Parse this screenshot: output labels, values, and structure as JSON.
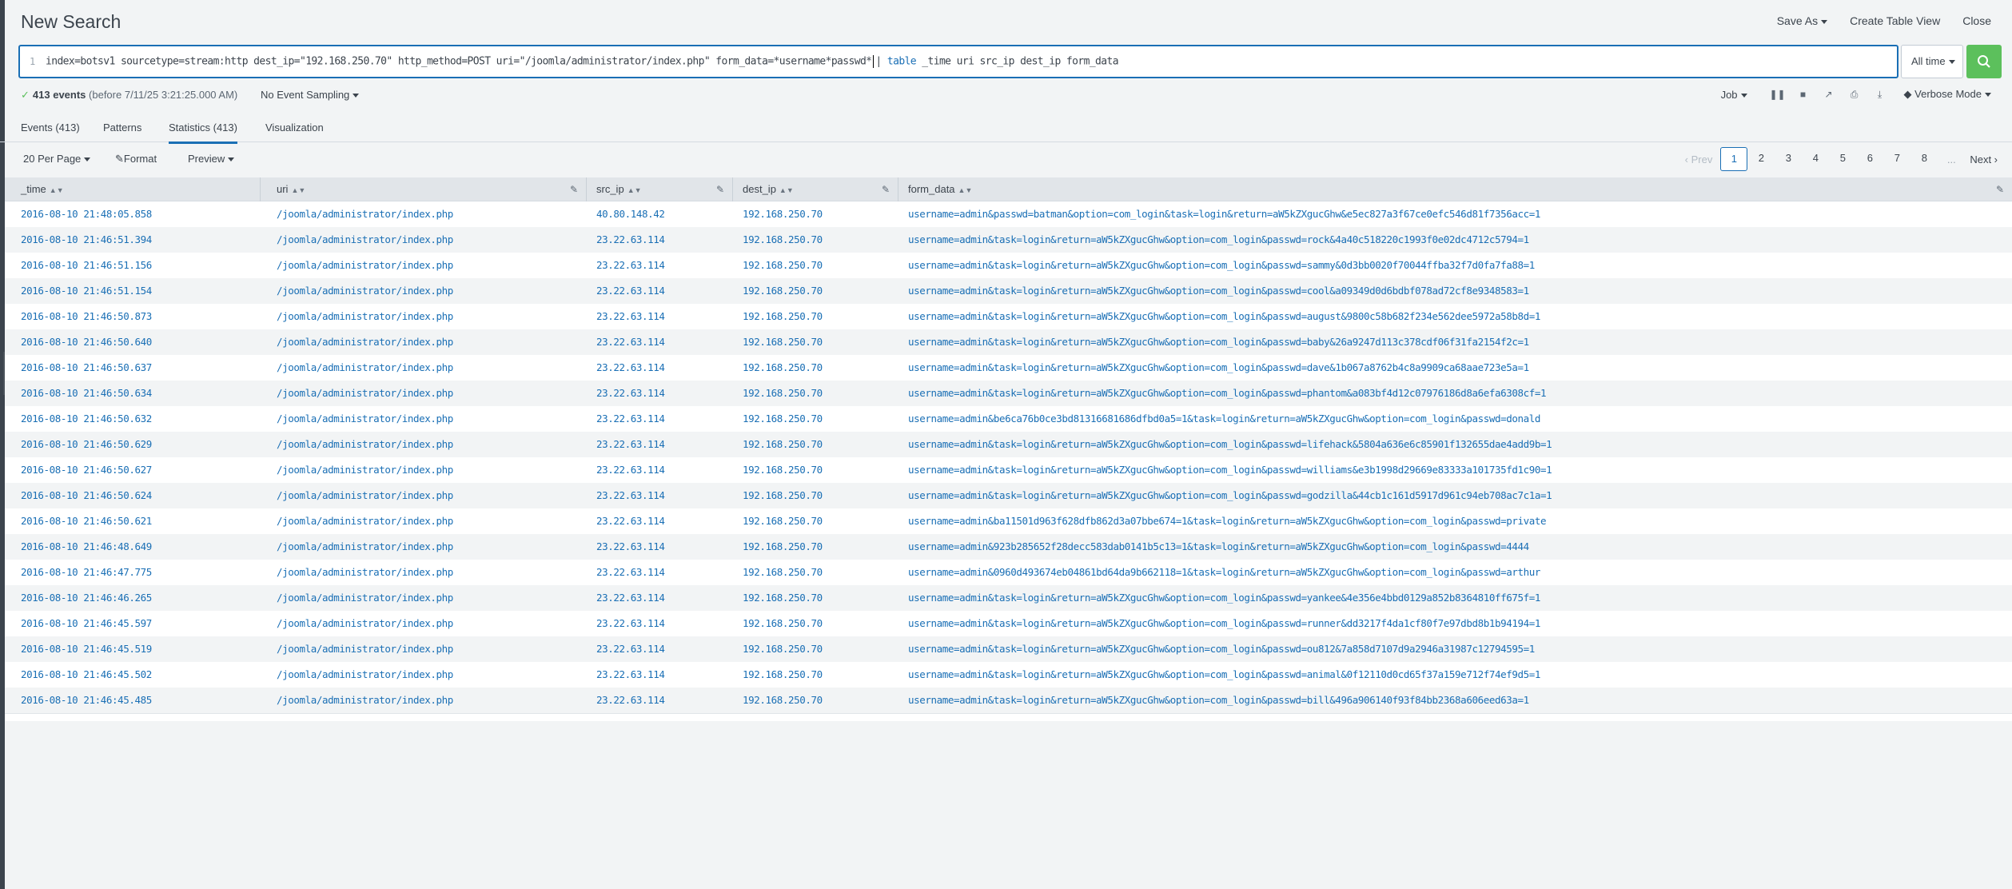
{
  "page": {
    "title": "New Search",
    "top_links": [
      "Save As",
      "Create Table View",
      "Close"
    ]
  },
  "search": {
    "line_number": "1",
    "query_part1": "index=botsv1 sourcetype=stream:http dest_ip=\"192.168.250.70\" http_method=POST uri=\"/joomla/administrator/index.php\" form_data=*username*passwd*",
    "pipe": "| ",
    "command": "table",
    "query_part2": " _time uri src_ip dest_ip form_data",
    "time_range": "All time"
  },
  "status": {
    "check": "✓",
    "events": "413 events",
    "sub": "(before 7/11/25 3:21:25.000 AM)",
    "sampling": "No Event Sampling",
    "job": "Job",
    "mode": "Verbose Mode"
  },
  "tabs": [
    "Events (413)",
    "Patterns",
    "Statistics (413)",
    "Visualization"
  ],
  "toolbar": {
    "per_page": "20 Per Page",
    "format": "Format",
    "preview": "Preview"
  },
  "pager": {
    "prev": "‹ Prev",
    "pages": [
      "1",
      "2",
      "3",
      "4",
      "5",
      "6",
      "7",
      "8"
    ],
    "dots": "...",
    "next": "Next ›",
    "current": "1"
  },
  "columns": [
    "_time",
    "uri",
    "src_ip",
    "dest_ip",
    "form_data"
  ],
  "rows": [
    [
      "2016-08-10 21:48:05.858",
      "/joomla/administrator/index.php",
      "40.80.148.42",
      "192.168.250.70",
      "username=admin&passwd=batman&option=com_login&task=login&return=aW5kZXgucGhw&e5ec827a3f67ce0efc546d81f7356acc=1"
    ],
    [
      "2016-08-10 21:46:51.394",
      "/joomla/administrator/index.php",
      "23.22.63.114",
      "192.168.250.70",
      "username=admin&task=login&return=aW5kZXgucGhw&option=com_login&passwd=rock&4a40c518220c1993f0e02dc4712c5794=1"
    ],
    [
      "2016-08-10 21:46:51.156",
      "/joomla/administrator/index.php",
      "23.22.63.114",
      "192.168.250.70",
      "username=admin&task=login&return=aW5kZXgucGhw&option=com_login&passwd=sammy&0d3bb0020f70044ffba32f7d0fa7fa88=1"
    ],
    [
      "2016-08-10 21:46:51.154",
      "/joomla/administrator/index.php",
      "23.22.63.114",
      "192.168.250.70",
      "username=admin&task=login&return=aW5kZXgucGhw&option=com_login&passwd=cool&a09349d0d6bdbf078ad72cf8e9348583=1"
    ],
    [
      "2016-08-10 21:46:50.873",
      "/joomla/administrator/index.php",
      "23.22.63.114",
      "192.168.250.70",
      "username=admin&task=login&return=aW5kZXgucGhw&option=com_login&passwd=august&9800c58b682f234e562dee5972a58b8d=1"
    ],
    [
      "2016-08-10 21:46:50.640",
      "/joomla/administrator/index.php",
      "23.22.63.114",
      "192.168.250.70",
      "username=admin&task=login&return=aW5kZXgucGhw&option=com_login&passwd=baby&26a9247d113c378cdf06f31fa2154f2c=1"
    ],
    [
      "2016-08-10 21:46:50.637",
      "/joomla/administrator/index.php",
      "23.22.63.114",
      "192.168.250.70",
      "username=admin&task=login&return=aW5kZXgucGhw&option=com_login&passwd=dave&1b067a8762b4c8a9909ca68aae723e5a=1"
    ],
    [
      "2016-08-10 21:46:50.634",
      "/joomla/administrator/index.php",
      "23.22.63.114",
      "192.168.250.70",
      "username=admin&task=login&return=aW5kZXgucGhw&option=com_login&passwd=phantom&a083bf4d12c07976186d8a6efa6308cf=1"
    ],
    [
      "2016-08-10 21:46:50.632",
      "/joomla/administrator/index.php",
      "23.22.63.114",
      "192.168.250.70",
      "username=admin&be6ca76b0ce3bd81316681686dfbd0a5=1&task=login&return=aW5kZXgucGhw&option=com_login&passwd=donald"
    ],
    [
      "2016-08-10 21:46:50.629",
      "/joomla/administrator/index.php",
      "23.22.63.114",
      "192.168.250.70",
      "username=admin&task=login&return=aW5kZXgucGhw&option=com_login&passwd=lifehack&5804a636e6c85901f132655dae4add9b=1"
    ],
    [
      "2016-08-10 21:46:50.627",
      "/joomla/administrator/index.php",
      "23.22.63.114",
      "192.168.250.70",
      "username=admin&task=login&return=aW5kZXgucGhw&option=com_login&passwd=williams&e3b1998d29669e83333a101735fd1c90=1"
    ],
    [
      "2016-08-10 21:46:50.624",
      "/joomla/administrator/index.php",
      "23.22.63.114",
      "192.168.250.70",
      "username=admin&task=login&return=aW5kZXgucGhw&option=com_login&passwd=godzilla&44cb1c161d5917d961c94eb708ac7c1a=1"
    ],
    [
      "2016-08-10 21:46:50.621",
      "/joomla/administrator/index.php",
      "23.22.63.114",
      "192.168.250.70",
      "username=admin&ba11501d963f628dfb862d3a07bbe674=1&task=login&return=aW5kZXgucGhw&option=com_login&passwd=private"
    ],
    [
      "2016-08-10 21:46:48.649",
      "/joomla/administrator/index.php",
      "23.22.63.114",
      "192.168.250.70",
      "username=admin&923b285652f28decc583dab0141b5c13=1&task=login&return=aW5kZXgucGhw&option=com_login&passwd=4444"
    ],
    [
      "2016-08-10 21:46:47.775",
      "/joomla/administrator/index.php",
      "23.22.63.114",
      "192.168.250.70",
      "username=admin&0960d493674eb04861bd64da9b662118=1&task=login&return=aW5kZXgucGhw&option=com_login&passwd=arthur"
    ],
    [
      "2016-08-10 21:46:46.265",
      "/joomla/administrator/index.php",
      "23.22.63.114",
      "192.168.250.70",
      "username=admin&task=login&return=aW5kZXgucGhw&option=com_login&passwd=yankee&4e356e4bbd0129a852b8364810ff675f=1"
    ],
    [
      "2016-08-10 21:46:45.597",
      "/joomla/administrator/index.php",
      "23.22.63.114",
      "192.168.250.70",
      "username=admin&task=login&return=aW5kZXgucGhw&option=com_login&passwd=runner&dd3217f4da1cf80f7e97dbd8b1b94194=1"
    ],
    [
      "2016-08-10 21:46:45.519",
      "/joomla/administrator/index.php",
      "23.22.63.114",
      "192.168.250.70",
      "username=admin&task=login&return=aW5kZXgucGhw&option=com_login&passwd=ou812&7a858d7107d9a2946a31987c12794595=1"
    ],
    [
      "2016-08-10 21:46:45.502",
      "/joomla/administrator/index.php",
      "23.22.63.114",
      "192.168.250.70",
      "username=admin&task=login&return=aW5kZXgucGhw&option=com_login&passwd=animal&0f12110d0cd65f37a159e712f74ef9d5=1"
    ],
    [
      "2016-08-10 21:46:45.485",
      "/joomla/administrator/index.php",
      "23.22.63.114",
      "192.168.250.70",
      "username=admin&task=login&return=aW5kZXgucGhw&option=com_login&passwd=bill&496a906140f93f84bb2368a606eed63a=1"
    ]
  ],
  "colors": {
    "accent": "#1a6fb5",
    "search_button": "#5cc05c",
    "header_bg": "#e1e5e9"
  }
}
